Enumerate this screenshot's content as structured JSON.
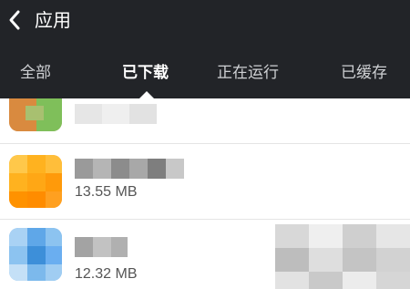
{
  "header": {
    "title": "应用",
    "back_icon": "chevron-left-icon",
    "background": "#222428"
  },
  "tabs": [
    {
      "label": "全部",
      "active": false
    },
    {
      "label": "已下载",
      "active": true
    },
    {
      "label": "正在运行",
      "active": false
    },
    {
      "label": "已缓存",
      "active": false
    }
  ],
  "apps": [
    {
      "size": "",
      "icon_colors": [
        "#d98a3f",
        "#7fbf5a",
        "#c9a06a"
      ]
    },
    {
      "size": "13.55 MB",
      "icon_colors": [
        "#ffb21f",
        "#ff8c00",
        "#ffc84a"
      ]
    },
    {
      "size": "12.32 MB",
      "icon_colors": [
        "#5fa7e8",
        "#8cc3f0",
        "#3d8fd9"
      ]
    }
  ]
}
